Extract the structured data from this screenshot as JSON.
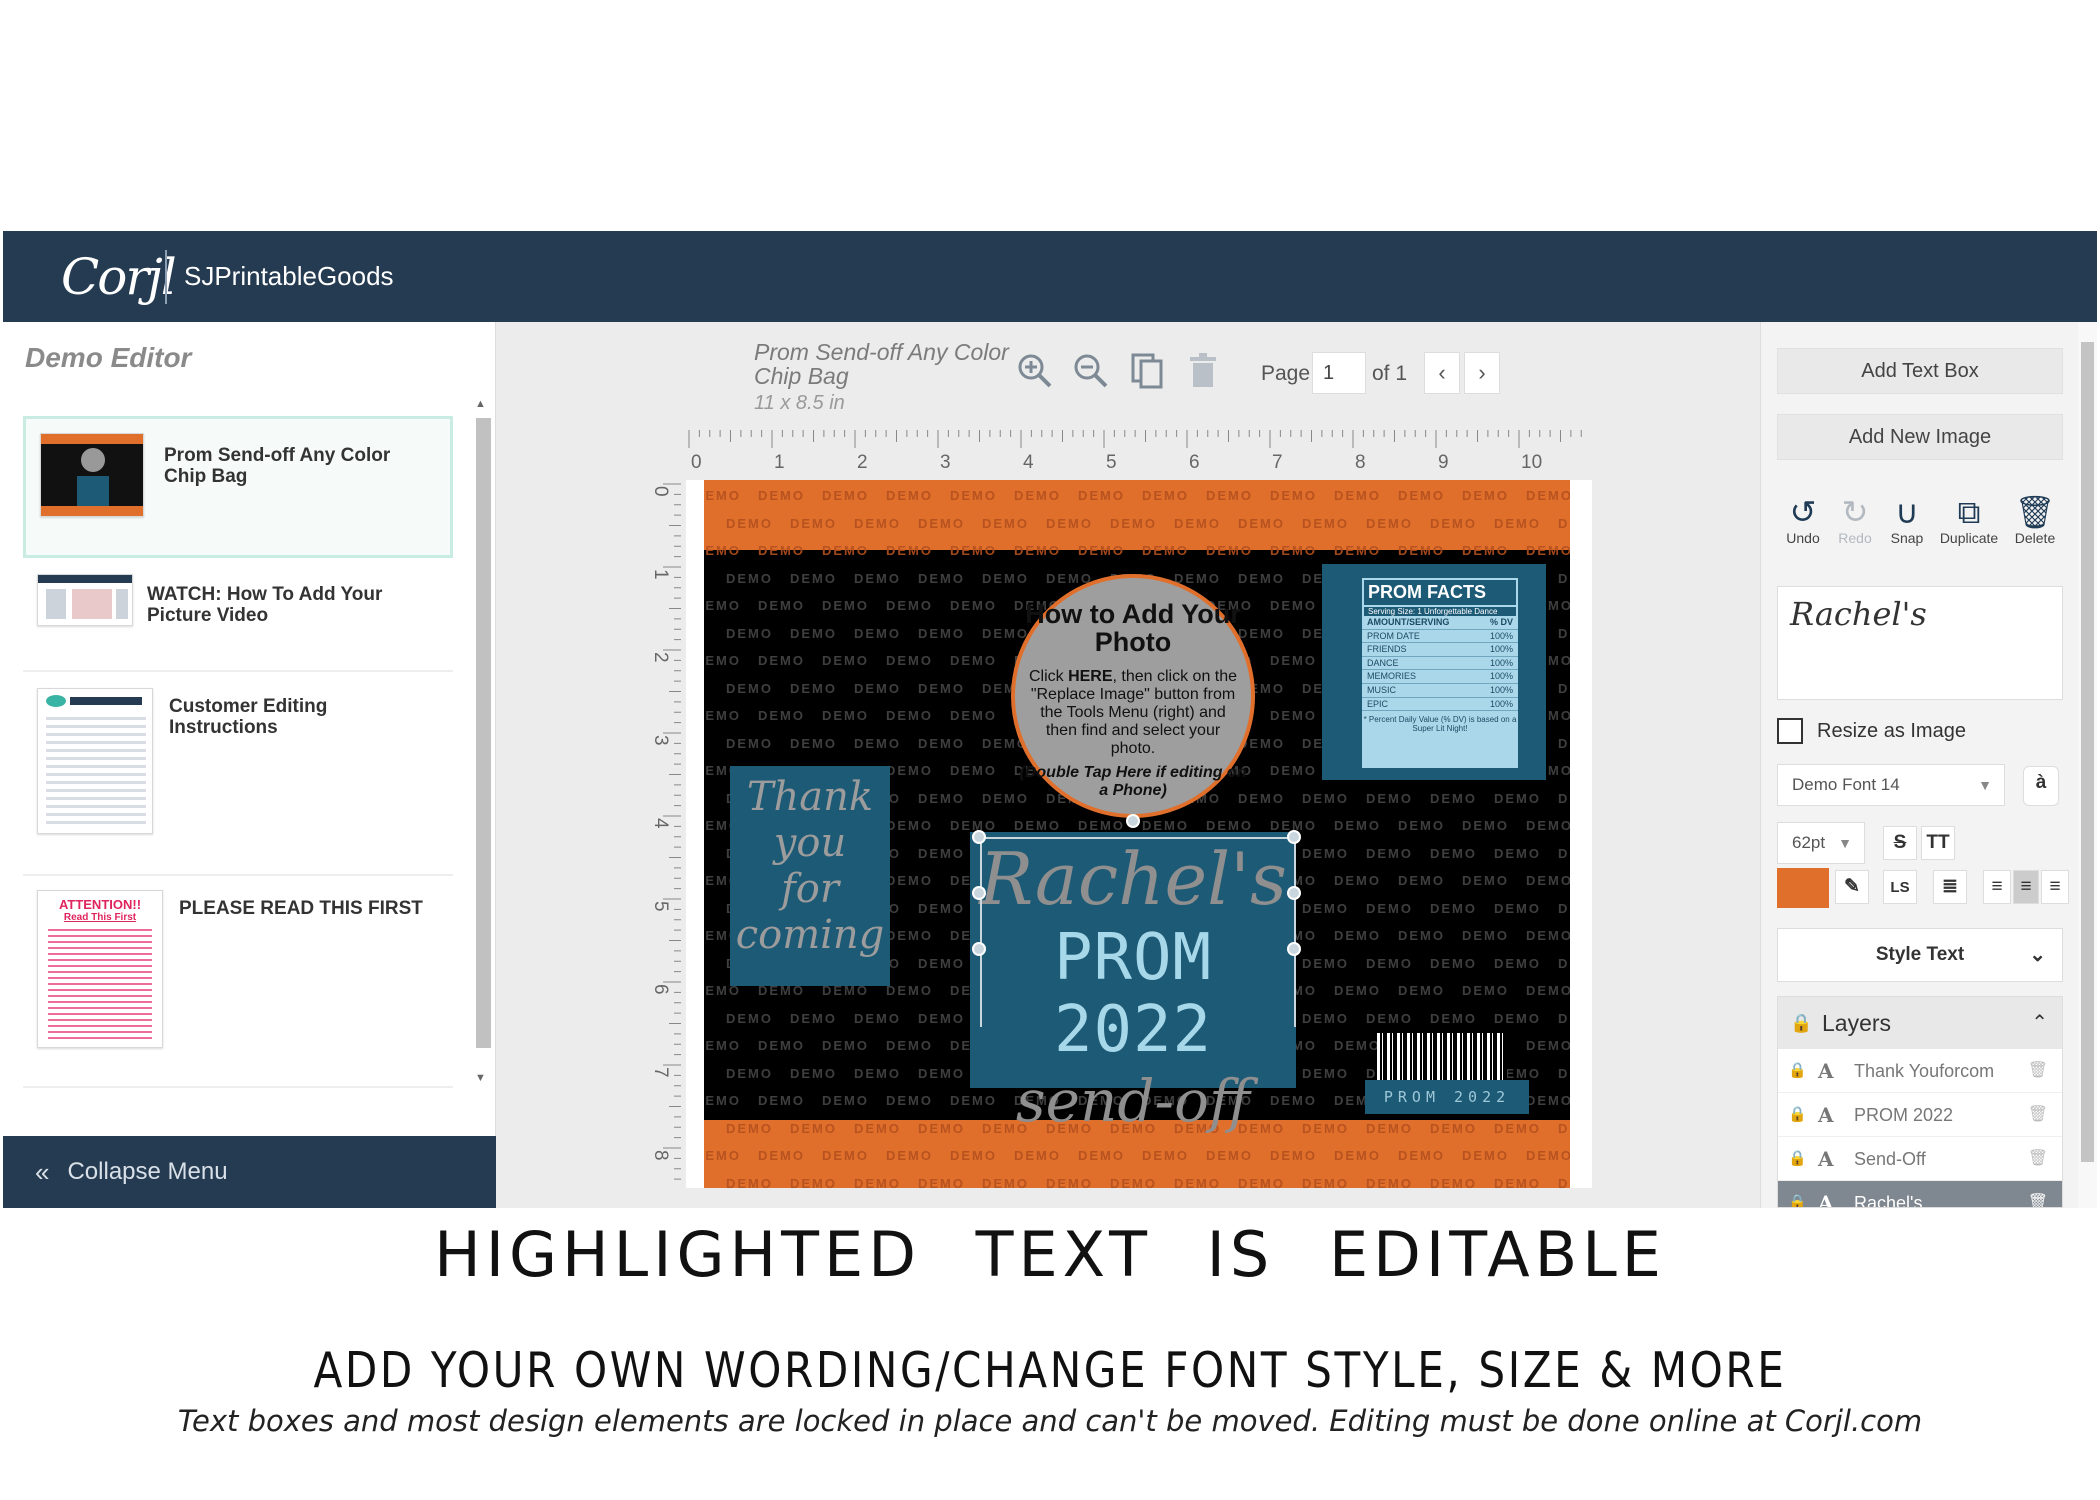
{
  "header": {
    "logo": "Corjl",
    "shop_name": "SJPrintableGoods"
  },
  "sidebar": {
    "title": "Demo Editor",
    "items": [
      {
        "label_line1": "Prom Send-off Any Color",
        "label_line2": "Chip Bag"
      },
      {
        "label_line1": "WATCH: How To Add Your",
        "label_line2": "Picture Video"
      },
      {
        "label_line1": "Customer Editing",
        "label_line2": "Instructions"
      },
      {
        "label_line1": "PLEASE READ THIS FIRST",
        "label_line2": ""
      }
    ],
    "attention_thumb": {
      "title": "ATTENTION!!",
      "subtitle": "Read This First"
    },
    "collapse_label": "Collapse Menu"
  },
  "toolbar": {
    "project_title": "Prom Send-off Any Color Chip Bag",
    "project_size": "11 x 8.5 in",
    "page_label": "Page",
    "page_value": "1",
    "page_of": "of 1"
  },
  "ruler": {
    "top": [
      "0",
      "1",
      "2",
      "3",
      "4",
      "5",
      "6",
      "7",
      "8",
      "9",
      "10"
    ],
    "left": [
      "0",
      "1",
      "2",
      "3",
      "4",
      "5",
      "6",
      "7",
      "8"
    ]
  },
  "artwork": {
    "watermark": "DEMO",
    "photo_title": "How to Add Your Photo",
    "photo_text_1": "Click ",
    "photo_text_here": "HERE",
    "photo_text_2": ", then click on the \"Replace Image\" button from the Tools Menu (right) and then find and select your photo.",
    "photo_note": "(Double Tap Here if editing on a Phone)",
    "facts_title": "PROM FACTS",
    "facts_sub": "Serving Size: 1 Unforgettable Dance",
    "facts_header_left": "AMOUNT/SERVING",
    "facts_header_right": "% DV",
    "facts_rows": [
      {
        "name": "PROM DATE",
        "value": "100%"
      },
      {
        "name": "FRIENDS",
        "value": "100%"
      },
      {
        "name": "DANCE",
        "value": "100%"
      },
      {
        "name": "MEMORIES",
        "value": "100%"
      },
      {
        "name": "MUSIC",
        "value": "100%"
      },
      {
        "name": "EPIC",
        "value": "100%"
      }
    ],
    "facts_foot": "* Percent Daily Value (% DV) is based on a Super Lit Night!",
    "thank_line1": "Thank",
    "thank_line2": "you",
    "thank_line3": "for",
    "thank_line4": "coming",
    "name_text": "Rachel's",
    "prom_text": "PROM 2022",
    "send_text": "send-off",
    "barcode_text": "PROM 2022"
  },
  "right_panel": {
    "add_text_box": "Add Text Box",
    "add_new_image": "Add New Image",
    "tools": [
      {
        "label": "Undo",
        "icon": "undo-icon"
      },
      {
        "label": "Redo",
        "icon": "redo-icon"
      },
      {
        "label": "Snap",
        "icon": "magnet-icon"
      },
      {
        "label": "Duplicate",
        "icon": "duplicate-icon"
      },
      {
        "label": "Delete",
        "icon": "trash-icon"
      }
    ],
    "text_preview": "Rachel's",
    "resize_label": "Resize as Image",
    "font_value": "Demo Font 14",
    "size_value": "62pt",
    "text_color": "#e06f2c",
    "style_text_label": "Style Text",
    "layers_title": "Layers",
    "layers": [
      {
        "name": "Thank Youforcom",
        "selected": false
      },
      {
        "name": "PROM 2022",
        "selected": false
      },
      {
        "name": "Send-Off",
        "selected": false
      },
      {
        "name": "Rachel's",
        "selected": true
      }
    ]
  },
  "captions": {
    "line1": "HIGHLIGHTED TEXT IS EDITABLE",
    "line2": "ADD YOUR OWN WORDING/CHANGE FONT STYLE, SIZE & MORE",
    "line3": "Text boxes and most design elements are locked in place and can't be moved. Editing must be done online at Corjl.com"
  },
  "colors": {
    "nav": "#253b51",
    "accent_orange": "#e06f2c",
    "box_blue": "#1d5a76",
    "light_blue": "#a7d8ea"
  }
}
